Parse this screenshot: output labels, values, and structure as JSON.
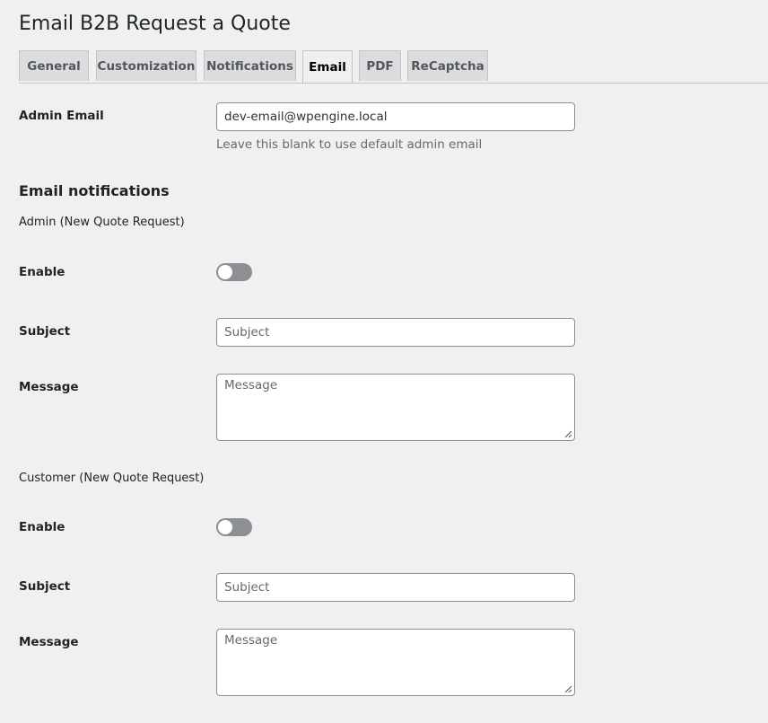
{
  "page": {
    "title": "Email B2B Request a Quote"
  },
  "tabs": [
    {
      "label": "General"
    },
    {
      "label": "Customization"
    },
    {
      "label": "Notifications"
    },
    {
      "label": "Email",
      "active": true
    },
    {
      "label": "PDF"
    },
    {
      "label": "ReCaptcha"
    }
  ],
  "admin_email": {
    "label": "Admin Email",
    "value": "dev-email@wpengine.local",
    "description": "Leave this blank to use default admin email"
  },
  "notifications": {
    "heading": "Email notifications",
    "admin": {
      "title": "Admin (New Quote Request)",
      "enable_label": "Enable",
      "enabled": false,
      "subject_label": "Subject",
      "subject_placeholder": "Subject",
      "message_label": "Message",
      "message_placeholder": "Message"
    },
    "customer": {
      "title": "Customer (New Quote Request)",
      "enable_label": "Enable",
      "enabled": false,
      "subject_label": "Subject",
      "subject_placeholder": "Subject",
      "message_label": "Message",
      "message_placeholder": "Message"
    }
  },
  "colors": {
    "background": "#f0f0f1",
    "toggle_off": "#8c8f94",
    "tab_inactive": "#dcdcde"
  }
}
